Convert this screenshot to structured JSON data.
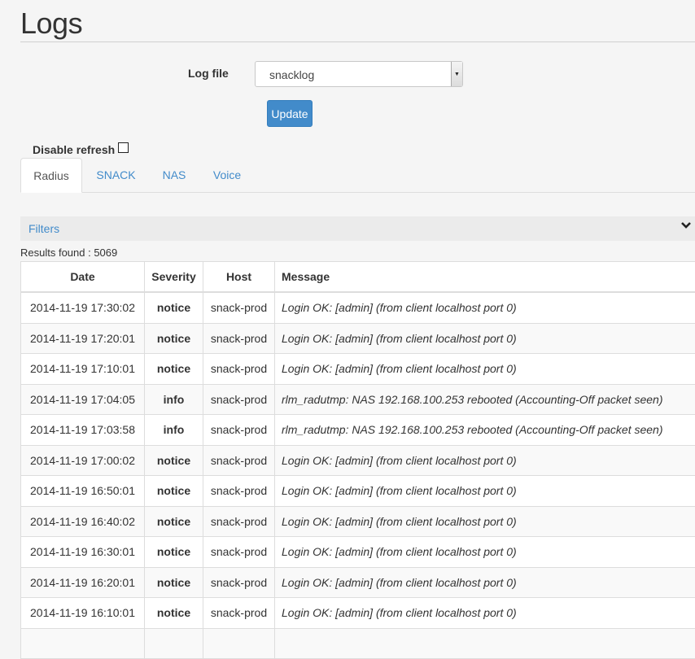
{
  "page": {
    "title": "Logs"
  },
  "logfile": {
    "label": "Log file",
    "selected": "snacklog",
    "update_label": "Update"
  },
  "disable_refresh_label": "Disable refresh",
  "tabs": [
    {
      "label": "Radius",
      "active": true
    },
    {
      "label": "SNACK",
      "active": false
    },
    {
      "label": "NAS",
      "active": false
    },
    {
      "label": "Voice",
      "active": false
    }
  ],
  "filters": {
    "label": "Filters",
    "icon": "chevron-down-icon"
  },
  "results_text": "Results found : 5069",
  "table": {
    "headers": [
      "Date",
      "Severity",
      "Host",
      "Message"
    ],
    "rows": [
      {
        "date": "2014-11-19 17:30:02",
        "severity": "notice",
        "host": "snack-prod",
        "message": "Login OK: [admin] (from client localhost port 0)"
      },
      {
        "date": "2014-11-19 17:20:01",
        "severity": "notice",
        "host": "snack-prod",
        "message": "Login OK: [admin] (from client localhost port 0)"
      },
      {
        "date": "2014-11-19 17:10:01",
        "severity": "notice",
        "host": "snack-prod",
        "message": "Login OK: [admin] (from client localhost port 0)"
      },
      {
        "date": "2014-11-19 17:04:05",
        "severity": "info",
        "host": "snack-prod",
        "message": "rlm_radutmp: NAS 192.168.100.253 rebooted (Accounting-Off packet seen)"
      },
      {
        "date": "2014-11-19 17:03:58",
        "severity": "info",
        "host": "snack-prod",
        "message": "rlm_radutmp: NAS 192.168.100.253 rebooted (Accounting-Off packet seen)"
      },
      {
        "date": "2014-11-19 17:00:02",
        "severity": "notice",
        "host": "snack-prod",
        "message": "Login OK: [admin] (from client localhost port 0)"
      },
      {
        "date": "2014-11-19 16:50:01",
        "severity": "notice",
        "host": "snack-prod",
        "message": "Login OK: [admin] (from client localhost port 0)"
      },
      {
        "date": "2014-11-19 16:40:02",
        "severity": "notice",
        "host": "snack-prod",
        "message": "Login OK: [admin] (from client localhost port 0)"
      },
      {
        "date": "2014-11-19 16:30:01",
        "severity": "notice",
        "host": "snack-prod",
        "message": "Login OK: [admin] (from client localhost port 0)"
      },
      {
        "date": "2014-11-19 16:20:01",
        "severity": "notice",
        "host": "snack-prod",
        "message": "Login OK: [admin] (from client localhost port 0)"
      },
      {
        "date": "2014-11-19 16:10:01",
        "severity": "notice",
        "host": "snack-prod",
        "message": "Login OK: [admin] (from client localhost port 0)"
      },
      {
        "date": "",
        "severity": "",
        "host": "",
        "message": ""
      }
    ]
  },
  "colors": {
    "link": "#428bca",
    "button": "#428bca",
    "background": "#f5f5f5"
  }
}
